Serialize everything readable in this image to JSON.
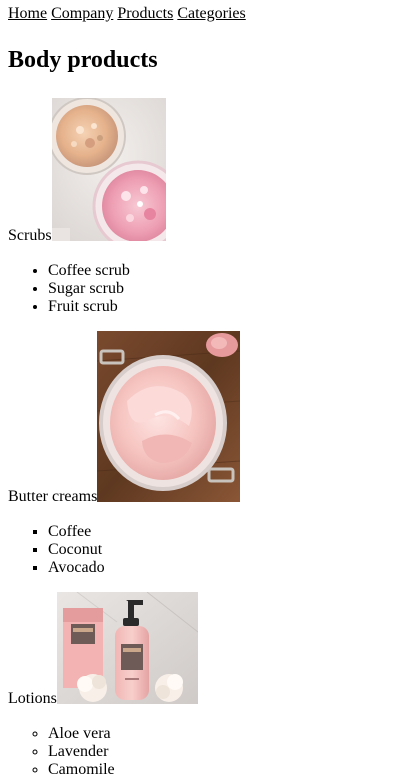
{
  "nav": {
    "items": [
      "Home",
      "Company",
      "Products",
      "Categories"
    ]
  },
  "page": {
    "title": "Body products"
  },
  "sections": [
    {
      "label": "Scrubs",
      "list_style": "disc",
      "items": [
        "Coffee scrub",
        "Sugar scrub",
        "Fruit scrub"
      ]
    },
    {
      "label": "Butter creams",
      "list_style": "square",
      "items": [
        "Coffee",
        "Coconut",
        "Avocado"
      ]
    },
    {
      "label": "Lotions",
      "list_style": "circle",
      "items": [
        "Aloe vera",
        "Lavender",
        "Camomile"
      ]
    }
  ]
}
